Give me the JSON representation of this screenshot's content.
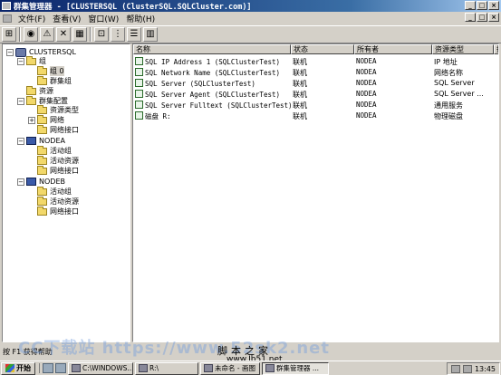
{
  "window": {
    "title": "群集管理器 - [CLUSTERSQL (ClusterSQL.SQLCluster.com)]",
    "controls": [
      "_",
      "□",
      "×"
    ]
  },
  "menu": {
    "items": [
      "文件(F)",
      "查看(V)",
      "窗口(W)",
      "帮助(H)"
    ]
  },
  "toolbar": {
    "buttons": [
      {
        "name": "open-connection-icon",
        "glyph": "⊞"
      },
      {
        "name": "bring-online-icon",
        "glyph": "◉"
      },
      {
        "name": "take-offline-icon",
        "glyph": "⚠"
      },
      {
        "name": "delete-icon",
        "glyph": "✕"
      },
      {
        "name": "properties-icon",
        "glyph": "▦"
      },
      {
        "name": "large-icons-icon",
        "glyph": "⊡"
      },
      {
        "name": "small-icons-icon",
        "glyph": "⋮"
      },
      {
        "name": "list-icon",
        "glyph": "☰"
      },
      {
        "name": "details-icon",
        "glyph": "▥"
      }
    ]
  },
  "tree": [
    {
      "label": "CLUSTERSQL",
      "level": 0,
      "icon": "cluster",
      "expander": "−"
    },
    {
      "label": "组",
      "level": 1,
      "icon": "folder",
      "expander": "−"
    },
    {
      "label": "组 0",
      "level": 2,
      "icon": "folder",
      "expander": "",
      "selected": true
    },
    {
      "label": "群集组",
      "level": 2,
      "icon": "folder",
      "expander": ""
    },
    {
      "label": "资源",
      "level": 1,
      "icon": "folder",
      "expander": ""
    },
    {
      "label": "群集配置",
      "level": 1,
      "icon": "folder",
      "expander": "−"
    },
    {
      "label": "资源类型",
      "level": 2,
      "icon": "folder",
      "expander": ""
    },
    {
      "label": "网络",
      "level": 2,
      "icon": "folder",
      "expander": "+"
    },
    {
      "label": "网络接口",
      "level": 2,
      "icon": "folder",
      "expander": ""
    },
    {
      "label": "NODEA",
      "level": 1,
      "icon": "node",
      "expander": "−"
    },
    {
      "label": "活动组",
      "level": 2,
      "icon": "folder",
      "expander": ""
    },
    {
      "label": "活动资源",
      "level": 2,
      "icon": "folder",
      "expander": ""
    },
    {
      "label": "网络接口",
      "level": 2,
      "icon": "folder",
      "expander": ""
    },
    {
      "label": "NODEB",
      "level": 1,
      "icon": "node",
      "expander": "−"
    },
    {
      "label": "活动组",
      "level": 2,
      "icon": "folder",
      "expander": ""
    },
    {
      "label": "活动资源",
      "level": 2,
      "icon": "folder",
      "expander": ""
    },
    {
      "label": "网络接口",
      "level": 2,
      "icon": "folder",
      "expander": ""
    }
  ],
  "list": {
    "columns": [
      "名称",
      "状态",
      "所有者",
      "资源类型",
      "描"
    ],
    "rows": [
      {
        "name": "SQL IP Address 1 (SQLClusterTest)",
        "state": "联机",
        "owner": "NODEA",
        "type": "IP 地址"
      },
      {
        "name": "SQL Network Name (SQLClusterTest)",
        "state": "联机",
        "owner": "NODEA",
        "type": "网络名称"
      },
      {
        "name": "SQL Server (SQLClusterTest)",
        "state": "联机",
        "owner": "NODEA",
        "type": "SQL Server"
      },
      {
        "name": "SQL Server Agent (SQLClusterTest)",
        "state": "联机",
        "owner": "NODEA",
        "type": "SQL Server ..."
      },
      {
        "name": "SQL Server Fulltext (SQLClusterTest)",
        "state": "联机",
        "owner": "NODEA",
        "type": "通用服务"
      },
      {
        "name": "磁盘 R:",
        "state": "联机",
        "owner": "NODEA",
        "type": "物理磁盘"
      }
    ]
  },
  "status": {
    "text": "按 F1 获得帮助"
  },
  "watermark": {
    "main": "CC下载站 https://www.52sk2.net",
    "center": "脚本之家",
    "url": "www.Jb51.net"
  },
  "taskbar": {
    "start": "开始",
    "tasks": [
      {
        "label": "C:\\WINDOWS...",
        "active": false
      },
      {
        "label": "R:\\",
        "active": false
      },
      {
        "label": "未命名 - 画图",
        "active": false
      },
      {
        "label": "群集管理器 ...",
        "active": true
      }
    ],
    "clock": "13:45"
  }
}
